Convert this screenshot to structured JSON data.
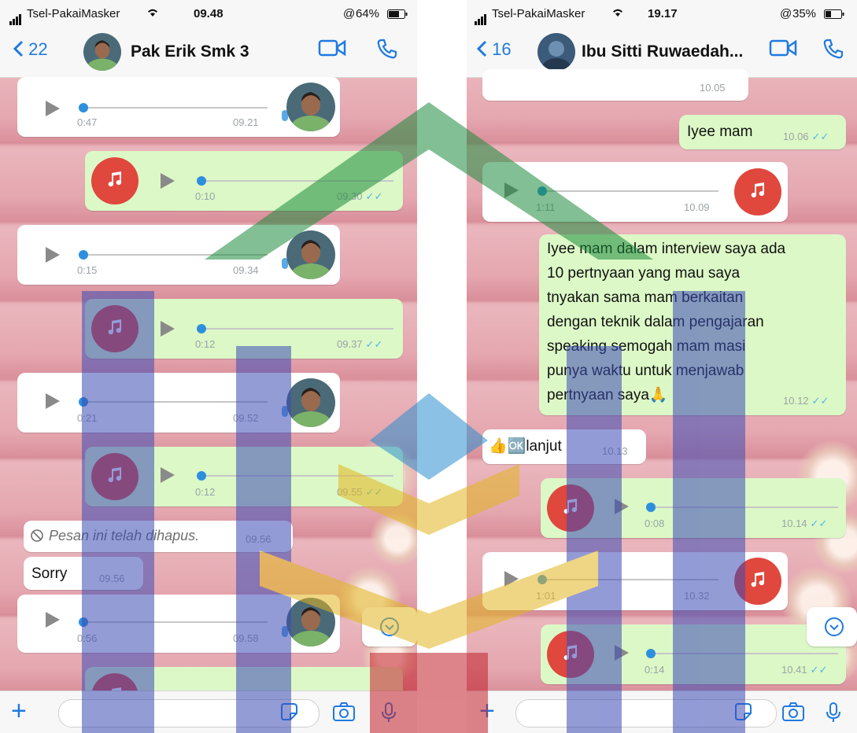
{
  "colors": {
    "ios_blue": "#1f7ae0",
    "incoming_bubble": "#ffffff",
    "outgoing_bubble": "#dcf8c6",
    "voice_note_icon": "#e0473d",
    "read_ticks": "#4fb6ec",
    "wallpaper": "#e9aeb6"
  },
  "left": {
    "status": {
      "carrier": "Tsel-PakaiMasker",
      "time": "09.48",
      "battery": "64%"
    },
    "header": {
      "back_count": "22",
      "contact": "Pak Erik Smk 3"
    },
    "messages": [
      {
        "duration": "0:47",
        "time": "09.21"
      },
      {
        "duration": "0:10",
        "time": "09.30",
        "ticks": "✓✓"
      },
      {
        "duration": "0:15",
        "time": "09.34"
      },
      {
        "duration": "0:12",
        "time": "09.37",
        "ticks": "✓✓"
      },
      {
        "duration": "0:21",
        "time": "09.52"
      },
      {
        "duration": "0:12",
        "time": "09.55",
        "ticks": "✓✓"
      },
      {
        "text": "Pesan ini telah dihapus.",
        "time": "09.56"
      },
      {
        "text": "Sorry",
        "time": "09.56"
      },
      {
        "duration": "0:56",
        "time": "09.58"
      }
    ]
  },
  "right": {
    "status": {
      "carrier": "Tsel-PakaiMasker",
      "time": "19.17",
      "battery": "35%"
    },
    "header": {
      "back_count": "16",
      "contact": "Ibu Sitti Ruwaedah..."
    },
    "messages": [
      {
        "time": "10.05"
      },
      {
        "text": "Iyee mam",
        "time": "10.06",
        "ticks": "✓✓"
      },
      {
        "duration": "1:11",
        "time": "10.09"
      },
      {
        "lines": [
          "Iyee mam dalam interview saya ada",
          "10 pertnyaan yang mau saya",
          "tnyakan sama mam berkaitan",
          "dengan teknik dalam pengajaran",
          "speaking semogah mam masi",
          "punya waktu untuk menjawab",
          "pertnyaan saya🙏"
        ],
        "time": "10.12",
        "ticks": "✓✓"
      },
      {
        "text": "👍🆗lanjut",
        "time": "10.13"
      },
      {
        "duration": "0:08",
        "time": "10.14",
        "ticks": "✓✓"
      },
      {
        "duration": "1:01",
        "time": "10.32"
      },
      {
        "duration": "0:14",
        "time": "10.41",
        "ticks": "✓✓"
      }
    ]
  }
}
